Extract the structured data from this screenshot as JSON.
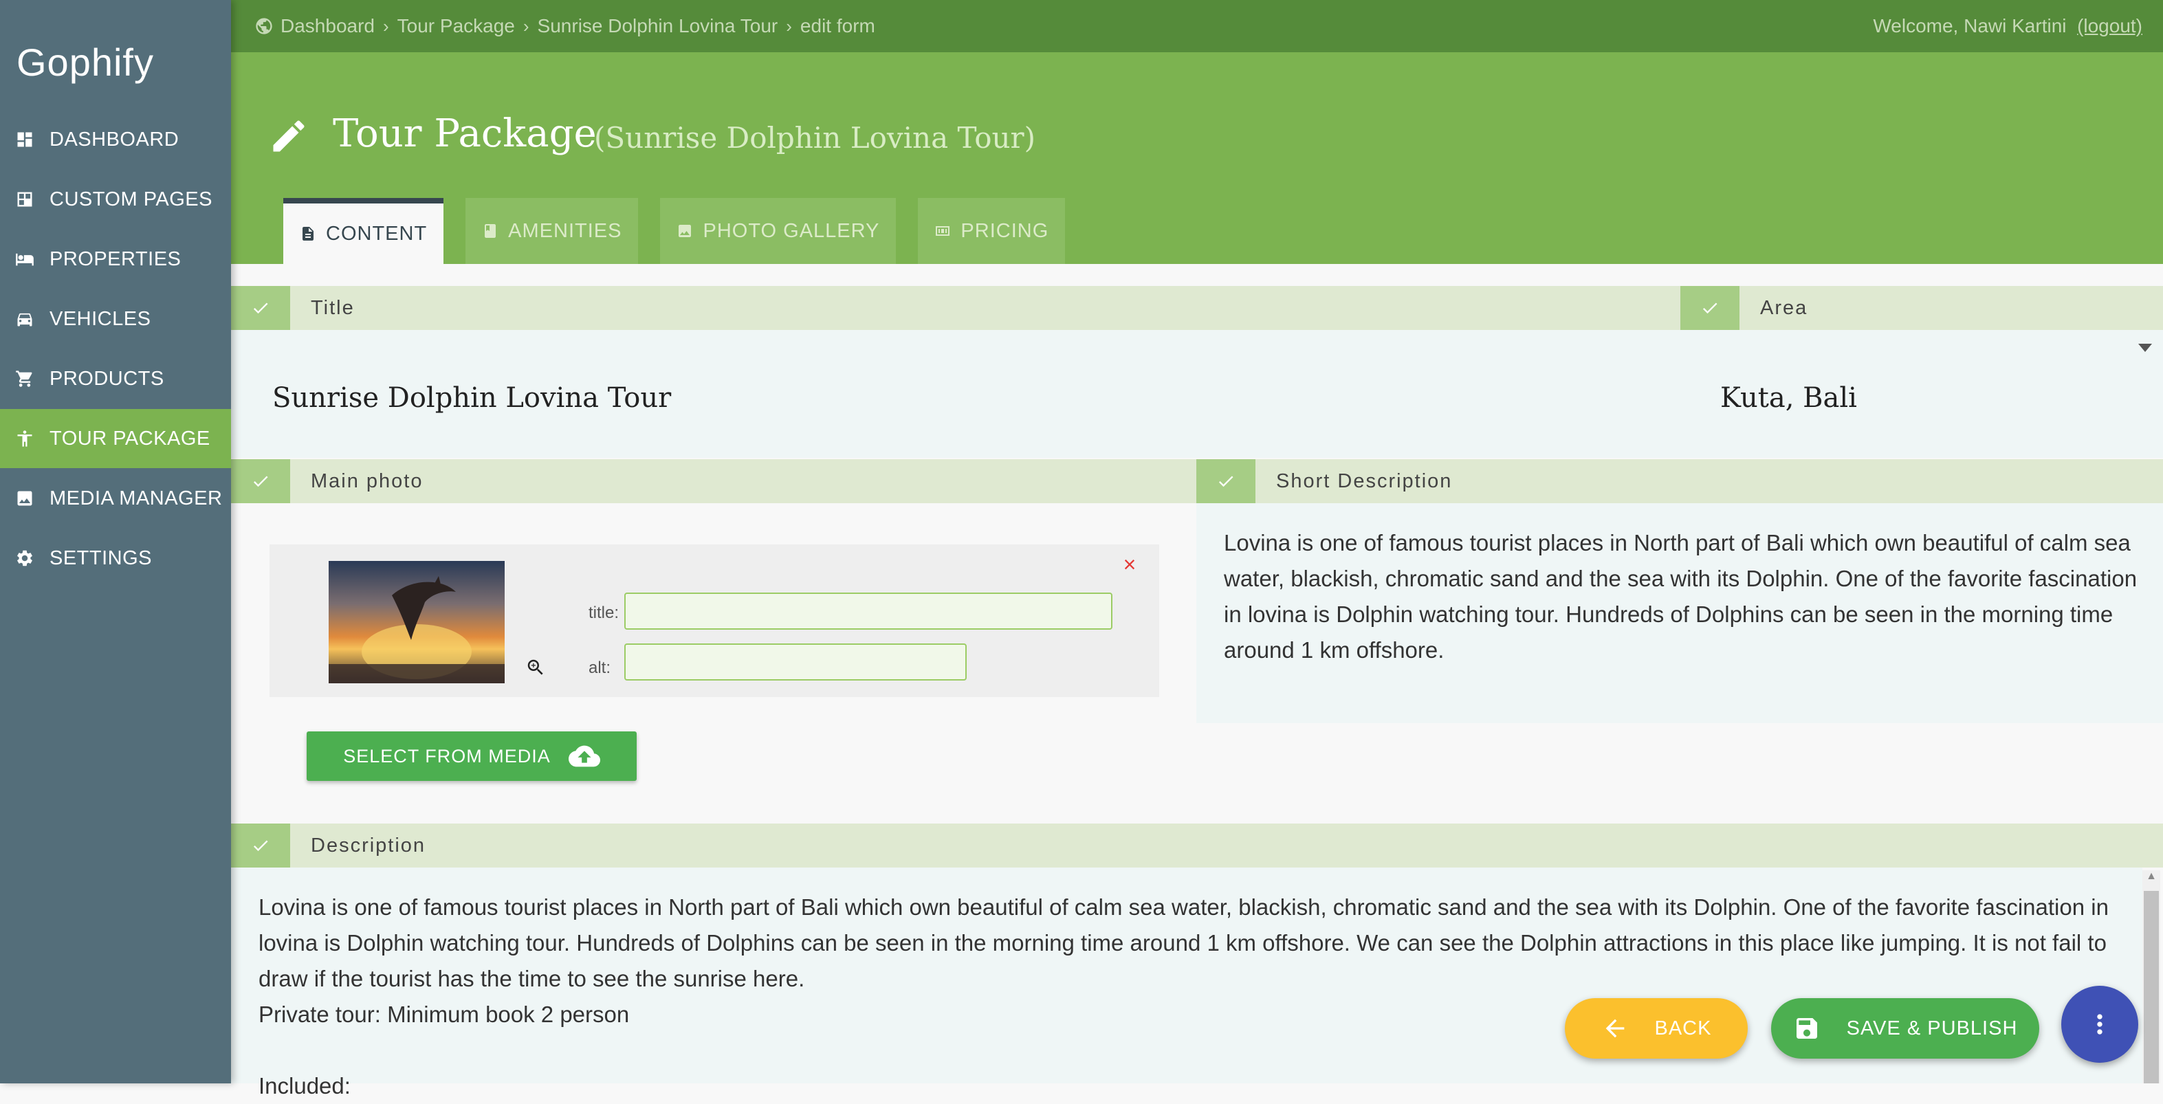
{
  "app": {
    "brand": "Gophify"
  },
  "sidebar": {
    "items": [
      {
        "label": "DASHBOARD",
        "icon": "dashboard-icon"
      },
      {
        "label": "CUSTOM PAGES",
        "icon": "custom-pages-icon"
      },
      {
        "label": "PROPERTIES",
        "icon": "bed-icon"
      },
      {
        "label": "VEHICLES",
        "icon": "car-icon"
      },
      {
        "label": "PRODUCTS",
        "icon": "cart-icon"
      },
      {
        "label": "TOUR PACKAGE",
        "icon": "person-icon",
        "active": true
      },
      {
        "label": "MEDIA MANAGER",
        "icon": "image-icon"
      },
      {
        "label": "SETTINGS",
        "icon": "gear-icon"
      }
    ]
  },
  "topbar": {
    "breadcrumb": [
      "Dashboard",
      "Tour Package",
      "Sunrise Dolphin Lovina Tour",
      "edit form"
    ],
    "welcome": "Welcome, Nawi Kartini",
    "logout": "(logout)"
  },
  "header": {
    "title": "Tour Package",
    "subtitle": "(Sunrise Dolphin Lovina Tour)",
    "tabs": [
      {
        "label": "CONTENT",
        "active": true
      },
      {
        "label": "AMENITIES"
      },
      {
        "label": "PHOTO GALLERY"
      },
      {
        "label": "PRICING"
      }
    ]
  },
  "form": {
    "title_label": "Title",
    "title_value": "Sunrise Dolphin Lovina Tour",
    "area_label": "Area",
    "area_value": "Kuta, Bali",
    "main_photo_label": "Main photo",
    "photo_title_label": "title:",
    "photo_title_value": "",
    "photo_alt_label": "alt:",
    "photo_alt_value": "",
    "remove_symbol": "×",
    "select_media_label": "SELECT FROM MEDIA",
    "short_description_label": "Short Description",
    "short_description_value": "Lovina is one of famous tourist places in North part of Bali which own beautiful of calm sea water, blackish, chromatic sand and the sea with its Dolphin. One of the favorite fascination in lovina is Dolphin watching tour. Hundreds of Dolphins can be seen in the morning time around 1 km offshore.",
    "description_label": "Description",
    "description_paragraph_1": "Lovina is one of famous tourist places in North part of Bali which own beautiful of calm sea water, blackish, chromatic sand and the sea with its Dolphin. One of the favorite fascination in lovina is Dolphin watching tour. Hundreds of Dolphins can be seen in the morning time around 1 km offshore. We can see the Dolphin attractions in this place like jumping. It is not fail to draw if the tourist has the time to see the sunrise here.",
    "description_paragraph_2": "Private tour: Minimum book 2 person",
    "description_paragraph_3": "Included:"
  },
  "actions": {
    "back_label": "BACK",
    "save_label": "SAVE & PUBLISH"
  },
  "colors": {
    "sidebar": "#546e7a",
    "header": "#7cb350",
    "topbar": "#558b3a",
    "back_button": "#fbc02d",
    "save_button": "#4caf50",
    "more_button": "#3f51b5"
  }
}
